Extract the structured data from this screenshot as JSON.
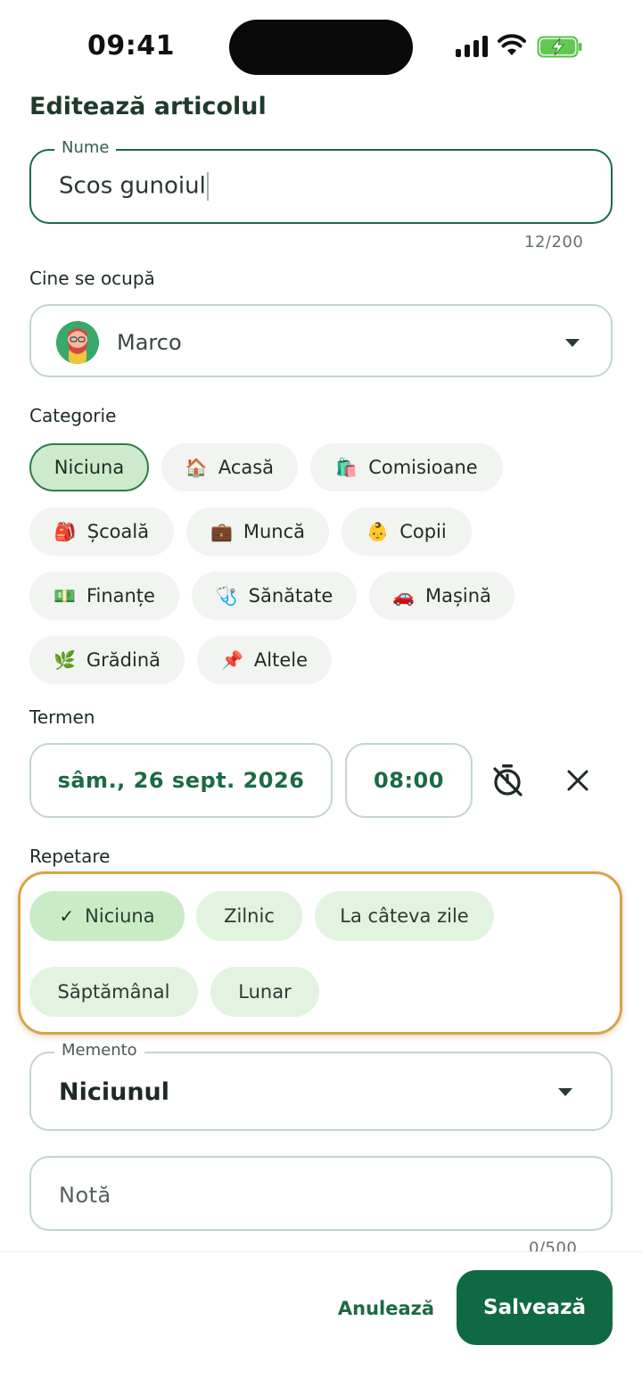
{
  "status_bar": {
    "time": "09:41"
  },
  "page_title": "Editează articolul",
  "name_field": {
    "label": "Nume",
    "value": "Scos gunoiul",
    "counter": "12/200"
  },
  "assignee": {
    "label": "Cine se ocupă",
    "name": "Marco"
  },
  "category": {
    "label": "Categorie",
    "chips": [
      {
        "emoji": "",
        "label": "Niciuna",
        "selected": true
      },
      {
        "emoji": "🏠",
        "label": "Acasă"
      },
      {
        "emoji": "🛍️",
        "label": "Comisioane"
      },
      {
        "emoji": "🎒",
        "label": "Școală"
      },
      {
        "emoji": "💼",
        "label": "Muncă"
      },
      {
        "emoji": "👶",
        "label": "Copii"
      },
      {
        "emoji": "💵",
        "label": "Finanțe"
      },
      {
        "emoji": "🩺",
        "label": "Sănătate"
      },
      {
        "emoji": "🚗",
        "label": "Mașină"
      },
      {
        "emoji": "🌿",
        "label": "Grădină"
      },
      {
        "emoji": "📌",
        "label": "Altele"
      }
    ]
  },
  "deadline": {
    "label": "Termen",
    "date": "sâm., 26 sept. 2026",
    "time": "08:00"
  },
  "repeat": {
    "label": "Repetare",
    "check_mark": "✓",
    "options": [
      {
        "label": "Niciuna",
        "selected": true
      },
      {
        "label": "Zilnic"
      },
      {
        "label": "La câteva zile"
      },
      {
        "label": "Săptămânal"
      },
      {
        "label": "Lunar"
      }
    ]
  },
  "reminder": {
    "label": "Memento",
    "value": "Niciunul"
  },
  "note": {
    "placeholder": "Notă",
    "counter": "0/500"
  },
  "actions": {
    "cancel": "Anulează",
    "save": "Salvează"
  },
  "colors": {
    "primary": "#0f6a44",
    "chip_selected": "#cdeacd",
    "highlight": "#d9a34a"
  }
}
